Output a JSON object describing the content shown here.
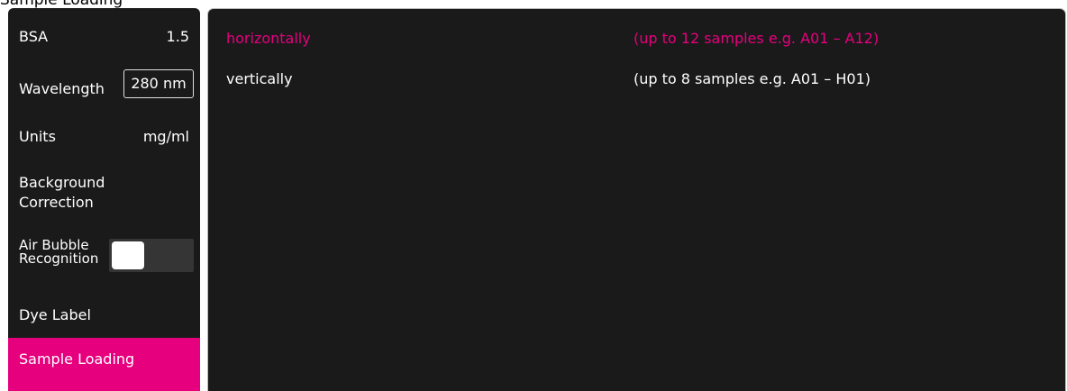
{
  "window": {
    "title": "Sample Loading"
  },
  "settings": {
    "bsa": {
      "label": "BSA",
      "value": "1.5"
    },
    "wavelength": {
      "label": "Wavelength",
      "value": "280 nm"
    },
    "units": {
      "label": "Units",
      "value": "mg/ml"
    },
    "background_correction": {
      "label": "Background Correction"
    },
    "air_bubble": {
      "label": "Air Bubble Recognition",
      "toggle_state": "off"
    },
    "dye_label": {
      "label": "Dye Label"
    },
    "sample_loading": {
      "label": "Sample Loading",
      "selected": true
    }
  },
  "options": [
    {
      "name": "horizontally",
      "description": "(up to 12 samples e.g. A01 – A12)",
      "selected": true
    },
    {
      "name": "vertically",
      "description": "(up to 8 samples e.g. A01 – H01)",
      "selected": false
    }
  ],
  "colors": {
    "accent": "#e6007e",
    "panel_bg": "#1a1a1a",
    "toggle_track": "#353535"
  }
}
